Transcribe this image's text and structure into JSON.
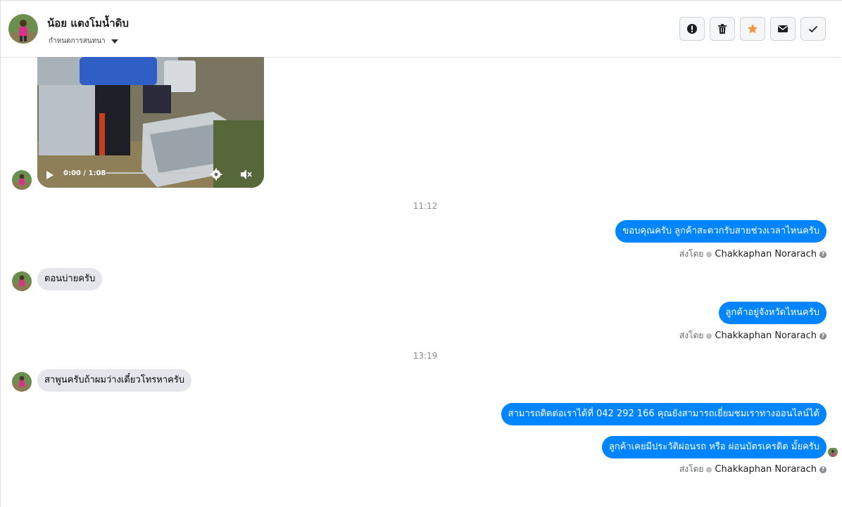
{
  "header": {
    "contact_name": "น้อย แตงโมน้ำดิบ",
    "assign_label": "กำหนดการสนทนา",
    "actions": [
      {
        "icon": "alert-icon"
      },
      {
        "icon": "trash-icon"
      },
      {
        "icon": "star-icon"
      },
      {
        "icon": "mail-icon"
      },
      {
        "icon": "check-icon"
      }
    ]
  },
  "video": {
    "time": "0:00 / 1:08"
  },
  "timestamps": [
    "11:12",
    "13:19"
  ],
  "messages": {
    "out1": "ขอบคุณครับ ลูกค้าสะดวกรับสายช่วงเวลาไหนครับ",
    "in1": "ตอนบ่ายครับ",
    "out2": "ลูกค้าอยู่จังหวัดไหนครับ",
    "in2": "สาพูนครับถ้าผมว่างเดี๋ยวโทรหาครับ",
    "out3": "สามารถติดต่อเราได้ที่ 042 292 166 คุณยังสามารถเยี่ยมชมเราทางออนไลน์ได้",
    "out4": "ลูกค้าเคยมีประวัติผ่อนรถ หรือ ผ่อนบัตรเครดิต มั้ยครับ"
  },
  "sent_by": {
    "label": "ส่งโดย",
    "name": "Chakkaphan Norarach"
  },
  "colors": {
    "outgoing": "#0084ff",
    "incoming": "#e4e6eb",
    "star": "#f7923a"
  }
}
